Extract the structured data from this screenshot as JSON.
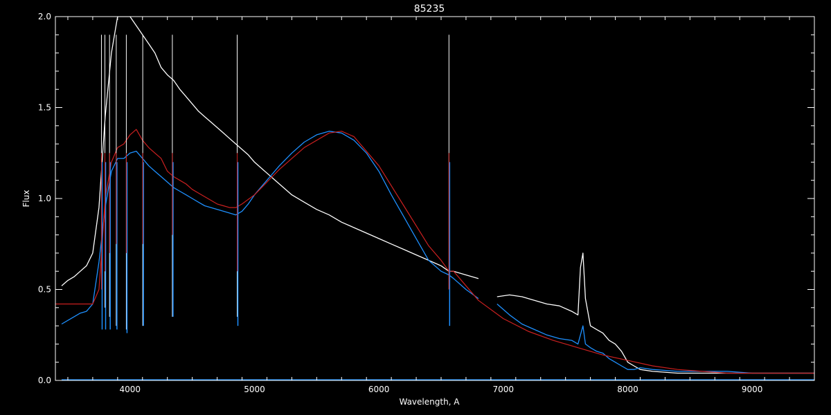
{
  "chart_data": {
    "type": "line",
    "title": "85235",
    "xlabel": "Wavelength, A",
    "ylabel": "Flux",
    "xlim": [
      3400,
      9500
    ],
    "ylim": [
      0.0,
      2.0
    ],
    "x_ticks": [
      4000,
      5000,
      6000,
      7000,
      8000,
      9000
    ],
    "x_tick_labels": [
      "4000",
      "5000",
      "6000",
      "7000",
      "8000",
      "9000"
    ],
    "y_ticks": [
      0.0,
      0.5,
      1.0,
      1.5,
      2.0
    ],
    "y_tick_labels": [
      "0.0",
      "0.5",
      "1.0",
      "1.5",
      "2.0"
    ],
    "grid": false,
    "background": "#000000",
    "axis_color": "#ffffff",
    "series": [
      {
        "color": "#ffffff",
        "segments": [
          {
            "x": [
              3450,
              3500,
              3550,
              3600,
              3650,
              3700,
              3750,
              3800,
              3850,
              3900,
              3950,
              4000,
              4050,
              4100,
              4150,
              4200,
              4250,
              4300,
              4350,
              4400,
              4450,
              4500,
              4550,
              4600,
              4650,
              4700,
              4750,
              4800,
              4850,
              4900,
              4950,
              5000,
              5100,
              5200,
              5300,
              5400,
              5500,
              5600,
              5700,
              5800,
              5900,
              6000,
              6100,
              6200,
              6300,
              6400,
              6500,
              6563,
              6600,
              6700,
              6800
            ],
            "y": [
              0.52,
              0.55,
              0.57,
              0.6,
              0.63,
              0.7,
              0.95,
              1.45,
              1.8,
              2.0,
              2.0,
              2.0,
              1.95,
              1.9,
              1.85,
              1.8,
              1.72,
              1.68,
              1.65,
              1.6,
              1.56,
              1.52,
              1.48,
              1.45,
              1.42,
              1.39,
              1.36,
              1.33,
              1.3,
              1.27,
              1.24,
              1.2,
              1.14,
              1.08,
              1.02,
              0.98,
              0.94,
              0.91,
              0.87,
              0.84,
              0.81,
              0.78,
              0.75,
              0.72,
              0.69,
              0.66,
              0.63,
              0.6,
              0.6,
              0.58,
              0.56
            ]
          },
          {
            "x": [
              6950,
              7050,
              7150,
              7250,
              7350,
              7450,
              7550,
              7600,
              7620,
              7640,
              7660,
              7700,
              7750,
              7800,
              7850,
              7900,
              7950,
              8000,
              8050,
              8100,
              8200,
              8400,
              8600,
              8800,
              9000,
              9200,
              9400,
              9500
            ],
            "y": [
              0.46,
              0.47,
              0.46,
              0.44,
              0.42,
              0.41,
              0.38,
              0.36,
              0.62,
              0.7,
              0.45,
              0.3,
              0.28,
              0.26,
              0.22,
              0.2,
              0.16,
              0.1,
              0.08,
              0.06,
              0.05,
              0.04,
              0.04,
              0.04,
              0.04,
              0.04,
              0.04,
              0.04
            ]
          }
        ]
      },
      {
        "color": "#1e90ff",
        "segments": [
          {
            "x": [
              3450,
              3500,
              3550,
              3600,
              3650,
              3700,
              3750,
              3800,
              3850,
              3900,
              3950,
              4000,
              4050,
              4100,
              4150,
              4200,
              4250,
              4300,
              4350,
              4400,
              4450,
              4500,
              4550,
              4600,
              4650,
              4700,
              4750,
              4800,
              4850,
              4900,
              4950,
              5000,
              5100,
              5200,
              5300,
              5400,
              5500,
              5600,
              5700,
              5800,
              5900,
              6000,
              6100,
              6200,
              6300,
              6400,
              6500,
              6563,
              6600,
              6700,
              6800
            ],
            "y": [
              0.31,
              0.33,
              0.35,
              0.37,
              0.38,
              0.42,
              0.65,
              0.95,
              1.15,
              1.22,
              1.22,
              1.25,
              1.26,
              1.22,
              1.18,
              1.15,
              1.12,
              1.09,
              1.06,
              1.04,
              1.02,
              1.0,
              0.98,
              0.96,
              0.95,
              0.94,
              0.93,
              0.92,
              0.91,
              0.93,
              0.97,
              1.02,
              1.1,
              1.18,
              1.25,
              1.31,
              1.35,
              1.37,
              1.36,
              1.32,
              1.25,
              1.15,
              1.02,
              0.9,
              0.78,
              0.66,
              0.6,
              0.58,
              0.56,
              0.5,
              0.45
            ]
          },
          {
            "x": [
              6950,
              7050,
              7150,
              7250,
              7350,
              7450,
              7550,
              7600,
              7620,
              7640,
              7660,
              7700,
              7750,
              7800,
              7850,
              7900,
              7950,
              8000,
              8050,
              8100,
              8200,
              8400,
              8600,
              8800,
              9000,
              9200,
              9400,
              9500
            ],
            "y": [
              0.42,
              0.36,
              0.31,
              0.28,
              0.25,
              0.23,
              0.22,
              0.2,
              0.25,
              0.3,
              0.2,
              0.18,
              0.16,
              0.15,
              0.12,
              0.1,
              0.08,
              0.06,
              0.06,
              0.07,
              0.06,
              0.05,
              0.05,
              0.05,
              0.04,
              0.04,
              0.04,
              0.04
            ]
          }
        ]
      },
      {
        "color": "#cc2020",
        "segments": [
          {
            "x": [
              3400,
              3500,
              3600,
              3700,
              3750,
              3800,
              3850,
              3900,
              3950,
              4000,
              4050,
              4100,
              4150,
              4200,
              4250,
              4300,
              4350,
              4400,
              4450,
              4500,
              4550,
              4600,
              4650,
              4700,
              4750,
              4800,
              4850,
              4900,
              5000,
              5200,
              5400,
              5600,
              5700,
              5800,
              6000,
              6200,
              6400,
              6500,
              6563,
              6600,
              6800,
              7000,
              7200,
              7400,
              7600,
              7800,
              8000,
              8200,
              8400,
              8600,
              8800,
              9000,
              9200,
              9400,
              9500
            ],
            "y": [
              0.42,
              0.42,
              0.42,
              0.42,
              0.5,
              1.0,
              1.2,
              1.28,
              1.3,
              1.35,
              1.38,
              1.32,
              1.28,
              1.25,
              1.22,
              1.15,
              1.12,
              1.1,
              1.08,
              1.05,
              1.03,
              1.01,
              0.99,
              0.97,
              0.96,
              0.95,
              0.95,
              0.97,
              1.02,
              1.16,
              1.28,
              1.36,
              1.37,
              1.34,
              1.18,
              0.96,
              0.74,
              0.66,
              0.6,
              0.6,
              0.44,
              0.34,
              0.27,
              0.22,
              0.18,
              0.14,
              0.11,
              0.08,
              0.06,
              0.05,
              0.04,
              0.04,
              0.04,
              0.04,
              0.04
            ]
          }
        ]
      }
    ],
    "absorption_lines": {
      "x": [
        3770,
        3798,
        3835,
        3889,
        3970,
        4102,
        4340,
        4861,
        6563
      ],
      "white_min": [
        0.5,
        0.4,
        0.35,
        0.3,
        0.28,
        0.3,
        0.35,
        0.35,
        0.5
      ],
      "blue_min": [
        0.28,
        0.28,
        0.28,
        0.28,
        0.26,
        0.3,
        0.35,
        0.3,
        0.3
      ],
      "red_min": [
        0.5,
        0.6,
        0.7,
        0.75,
        0.7,
        0.75,
        0.8,
        0.6,
        0.5
      ]
    },
    "baseline": {
      "color": "#1e90ff",
      "y": 0.0
    }
  }
}
